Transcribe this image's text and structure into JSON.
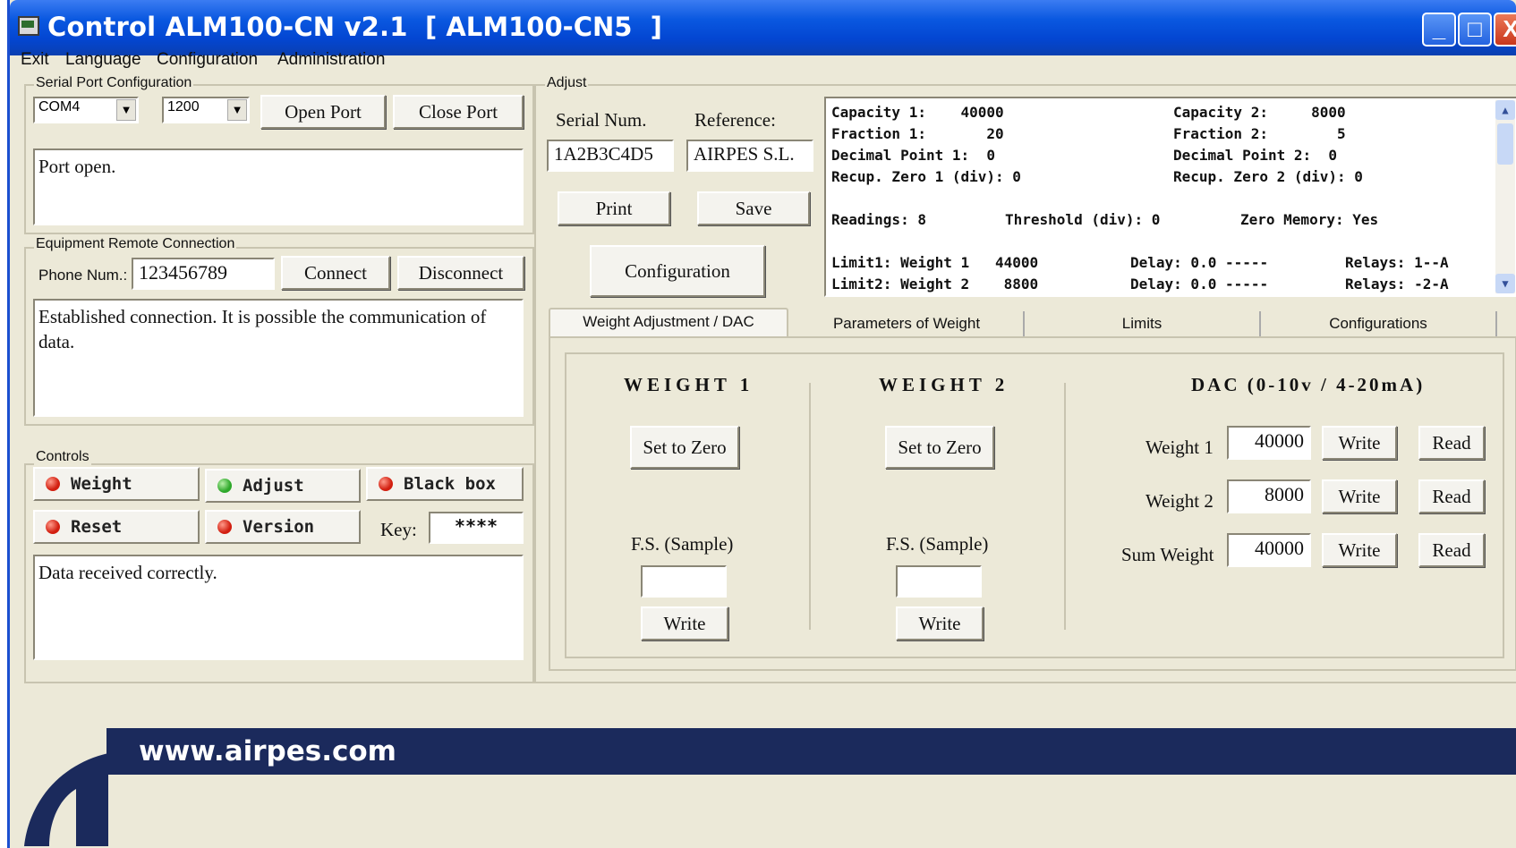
{
  "window": {
    "title": "Control ALM100-CN v2.1",
    "device": "[ ALM100-CN5  ]",
    "min_glyph": "_",
    "max_glyph": "□",
    "close_glyph": "X"
  },
  "menu": [
    "Exit",
    "Language",
    "Configuration",
    "Administration"
  ],
  "serial": {
    "legend": "Serial Port Configuration",
    "port": "COM4",
    "baud": "1200",
    "open": "Open Port",
    "close": "Close Port",
    "status": "Port open."
  },
  "remote": {
    "legend": "Equipment Remote Connection",
    "phone_label": "Phone Num.:",
    "phone": "123456789",
    "connect": "Connect",
    "disconnect": "Disconnect",
    "status": "Established connection. It is possible the communication of data."
  },
  "controls": {
    "legend": "Controls",
    "weight": "Weight",
    "adjust": "Adjust",
    "blackbox": "Black box",
    "reset": "Reset",
    "version": "Version",
    "key_label": "Key:",
    "key": "****",
    "status": "Data received correctly.",
    "indicators": {
      "weight": "red",
      "adjust": "green",
      "blackbox": "red",
      "reset": "red",
      "version": "red"
    }
  },
  "adjust": {
    "legend": "Adjust",
    "serial_label": "Serial Num.",
    "reference_label": "Reference:",
    "serial": "1A2B3C4D5",
    "reference": "AIRPES S.L.",
    "print": "Print",
    "save": "Save",
    "configuration": "Configuration"
  },
  "info": {
    "cap1": "Capacity 1:    40000",
    "cap2": "Capacity 2:     8000",
    "frac1": "Fraction 1:       20",
    "frac2": "Fraction 2:        5",
    "dp1": "Decimal Point 1:  0",
    "dp2": "Decimal Point 2:  0",
    "rz1": "Recup. Zero 1 (div): 0",
    "rz2": "Recup. Zero 2 (div): 0",
    "readings": "Readings: 8",
    "threshold": "Threshold (div): 0",
    "zeromem": "Zero Memory: Yes",
    "lim1": "Limit1: Weight 1   44000",
    "lim2": "Limit2: Weight 2    8800",
    "delay1": "Delay: 0.0 -----",
    "delay2": "Delay: 0.0 -----",
    "relays1": "Relays: 1--A",
    "relays2": "Relays: -2-A"
  },
  "tabs": [
    "Weight Adjustment / DAC",
    "Parameters of Weight",
    "Limits",
    "Configurations"
  ],
  "w1": {
    "title": "WEIGHT 1",
    "zero": "Set to Zero",
    "fs": "F.S. (Sample)",
    "value": "",
    "write": "Write"
  },
  "w2": {
    "title": "WEIGHT 2",
    "zero": "Set to Zero",
    "fs": "F.S. (Sample)",
    "value": "",
    "write": "Write"
  },
  "dac": {
    "title": "DAC (0-10v / 4-20mA)",
    "rows": [
      {
        "label": "Weight 1",
        "value": "40000",
        "write": "Write",
        "read": "Read"
      },
      {
        "label": "Weight 2",
        "value": "8000",
        "write": "Write",
        "read": "Read"
      },
      {
        "label": "Sum Weight",
        "value": "40000",
        "write": "Write",
        "read": "Read"
      }
    ]
  },
  "footer": {
    "url": "www.airpes.com"
  },
  "colors": {
    "title_bar": "#0a58e0",
    "footer_band": "#1b2a5c",
    "led_red": "#d21f10",
    "led_green": "#2ea82a"
  }
}
